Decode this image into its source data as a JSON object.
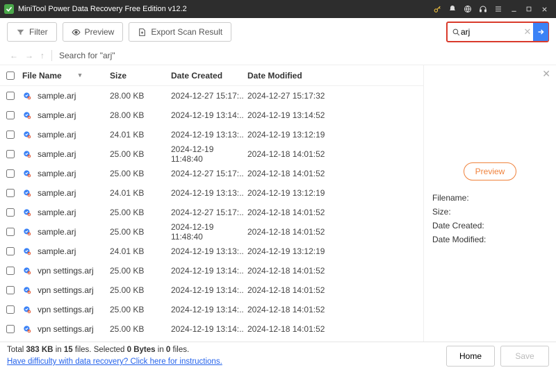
{
  "titlebar": {
    "title": "MiniTool Power Data Recovery Free Edition v12.2"
  },
  "toolbar": {
    "filter_label": "Filter",
    "preview_label": "Preview",
    "export_label": "Export Scan Result"
  },
  "search": {
    "value": "arj"
  },
  "nav": {
    "search_label": "Search for  \"arj\""
  },
  "columns": {
    "name": "File Name",
    "size": "Size",
    "created": "Date Created",
    "modified": "Date Modified"
  },
  "rows": [
    {
      "name": "sample.arj",
      "size": "28.00 KB",
      "created": "2024-12-27 15:17:..",
      "modified": "2024-12-27 15:17:32"
    },
    {
      "name": "sample.arj",
      "size": "28.00 KB",
      "created": "2024-12-19 13:14:..",
      "modified": "2024-12-19 13:14:52"
    },
    {
      "name": "sample.arj",
      "size": "24.01 KB",
      "created": "2024-12-19 13:13:..",
      "modified": "2024-12-19 13:12:19"
    },
    {
      "name": "sample.arj",
      "size": "25.00 KB",
      "created": "2024-12-19 11:48:40",
      "modified": "2024-12-18 14:01:52"
    },
    {
      "name": "sample.arj",
      "size": "25.00 KB",
      "created": "2024-12-27 15:17:..",
      "modified": "2024-12-18 14:01:52"
    },
    {
      "name": "sample.arj",
      "size": "24.01 KB",
      "created": "2024-12-19 13:13:..",
      "modified": "2024-12-19 13:12:19"
    },
    {
      "name": "sample.arj",
      "size": "25.00 KB",
      "created": "2024-12-27 15:17:..",
      "modified": "2024-12-18 14:01:52"
    },
    {
      "name": "sample.arj",
      "size": "25.00 KB",
      "created": "2024-12-19 11:48:40",
      "modified": "2024-12-18 14:01:52"
    },
    {
      "name": "sample.arj",
      "size": "24.01 KB",
      "created": "2024-12-19 13:13:..",
      "modified": "2024-12-19 13:12:19"
    },
    {
      "name": "vpn settings.arj",
      "size": "25.00 KB",
      "created": "2024-12-19 13:14:..",
      "modified": "2024-12-18 14:01:52"
    },
    {
      "name": "vpn settings.arj",
      "size": "25.00 KB",
      "created": "2024-12-19 13:14:..",
      "modified": "2024-12-18 14:01:52"
    },
    {
      "name": "vpn settings.arj",
      "size": "25.00 KB",
      "created": "2024-12-19 13:14:..",
      "modified": "2024-12-18 14:01:52"
    },
    {
      "name": "vpn settings.arj",
      "size": "25.00 KB",
      "created": "2024-12-19 13:14:..",
      "modified": "2024-12-18 14:01:52"
    }
  ],
  "preview": {
    "button": "Preview",
    "filename_label": "Filename:",
    "size_label": "Size:",
    "created_label": "Date Created:",
    "modified_label": "Date Modified:"
  },
  "footer": {
    "total_prefix": "Total ",
    "total_size": "383 KB",
    "total_mid": " in ",
    "total_files": "15",
    "total_suffix": " files.",
    "sel_prefix": "  Selected ",
    "sel_bytes": "0 Bytes",
    "sel_mid": " in ",
    "sel_files": "0",
    "sel_suffix": " files.",
    "help_link": "Have difficulty with data recovery? Click here for instructions.",
    "home": "Home",
    "save": "Save"
  }
}
